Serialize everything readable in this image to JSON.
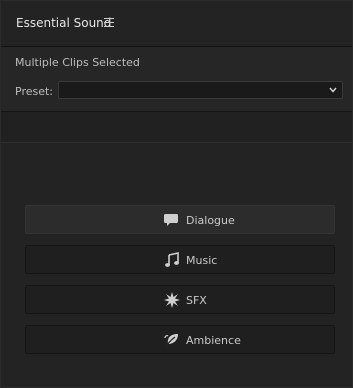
{
  "panel": {
    "title": "Essential Sound",
    "menu_icon": "hamburger-menu-icon"
  },
  "selection": {
    "label": "Multiple Clips Selected"
  },
  "preset": {
    "label": "Preset:",
    "value": "",
    "dropdown_icon": "chevron-down-icon"
  },
  "audio_types": [
    {
      "label": "Dialogue",
      "icon": "speech-bubble-icon",
      "active": true
    },
    {
      "label": "Music",
      "icon": "music-note-icon",
      "active": false
    },
    {
      "label": "SFX",
      "icon": "burst-icon",
      "active": false
    },
    {
      "label": "Ambience",
      "icon": "leaf-icon",
      "active": false
    }
  ]
}
